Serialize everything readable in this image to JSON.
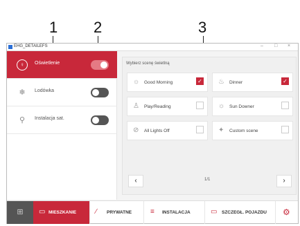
{
  "callouts": [
    "1",
    "2",
    "3"
  ],
  "window": {
    "title": "EHG_DETAILEFS",
    "controls": [
      "–",
      "□",
      "×"
    ]
  },
  "sidebar": {
    "items": [
      {
        "label": "Oświetlenie",
        "icon": "bulb-icon",
        "glyph": "♀",
        "active": true,
        "toggle": true
      },
      {
        "label": "Lodówka",
        "icon": "snowflake-icon",
        "glyph": "❄",
        "active": false,
        "toggle": false
      },
      {
        "label": "Instalacja sat.",
        "icon": "satellite-icon",
        "glyph": "⚲",
        "active": false,
        "toggle": false
      }
    ]
  },
  "scenes": {
    "title": "Wybierz scenę świetlną",
    "items": [
      {
        "label": "Good Morning",
        "icon": "sun-icon",
        "glyph": "☼",
        "checked": true
      },
      {
        "label": "Dinner",
        "icon": "dinner-icon",
        "glyph": "♨",
        "checked": true
      },
      {
        "label": "Play/Reading",
        "icon": "reading-icon",
        "glyph": "♙",
        "checked": false
      },
      {
        "label": "Sun Downer",
        "icon": "sunset-icon",
        "glyph": "☼",
        "checked": false
      },
      {
        "label": "All Lights Off",
        "icon": "lights-off-icon",
        "glyph": "⊘",
        "checked": false
      },
      {
        "label": "Custom scene",
        "icon": "custom-scene-icon",
        "glyph": "✦",
        "checked": false
      }
    ],
    "check_glyph": "✓",
    "prev": "‹",
    "next": "›",
    "page": "1/1"
  },
  "bottom": {
    "grid_glyph": "⊞",
    "tabs": [
      {
        "label": "MIESZKANIE",
        "icon": "house-icon",
        "glyph": "▭",
        "active": true
      },
      {
        "label": "PRYWATNE",
        "icon": "private-icon",
        "glyph": "⁄",
        "active": false
      },
      {
        "label": "INSTALACJA",
        "icon": "installation-icon",
        "glyph": "≡",
        "active": false
      },
      {
        "label": "SZCZEGŁ. POJAZDU",
        "icon": "vehicle-icon",
        "glyph": "▭",
        "active": false
      }
    ],
    "settings_glyph": "⚙"
  },
  "colors": {
    "accent": "#c8283a",
    "toggle_off": "#555555"
  }
}
